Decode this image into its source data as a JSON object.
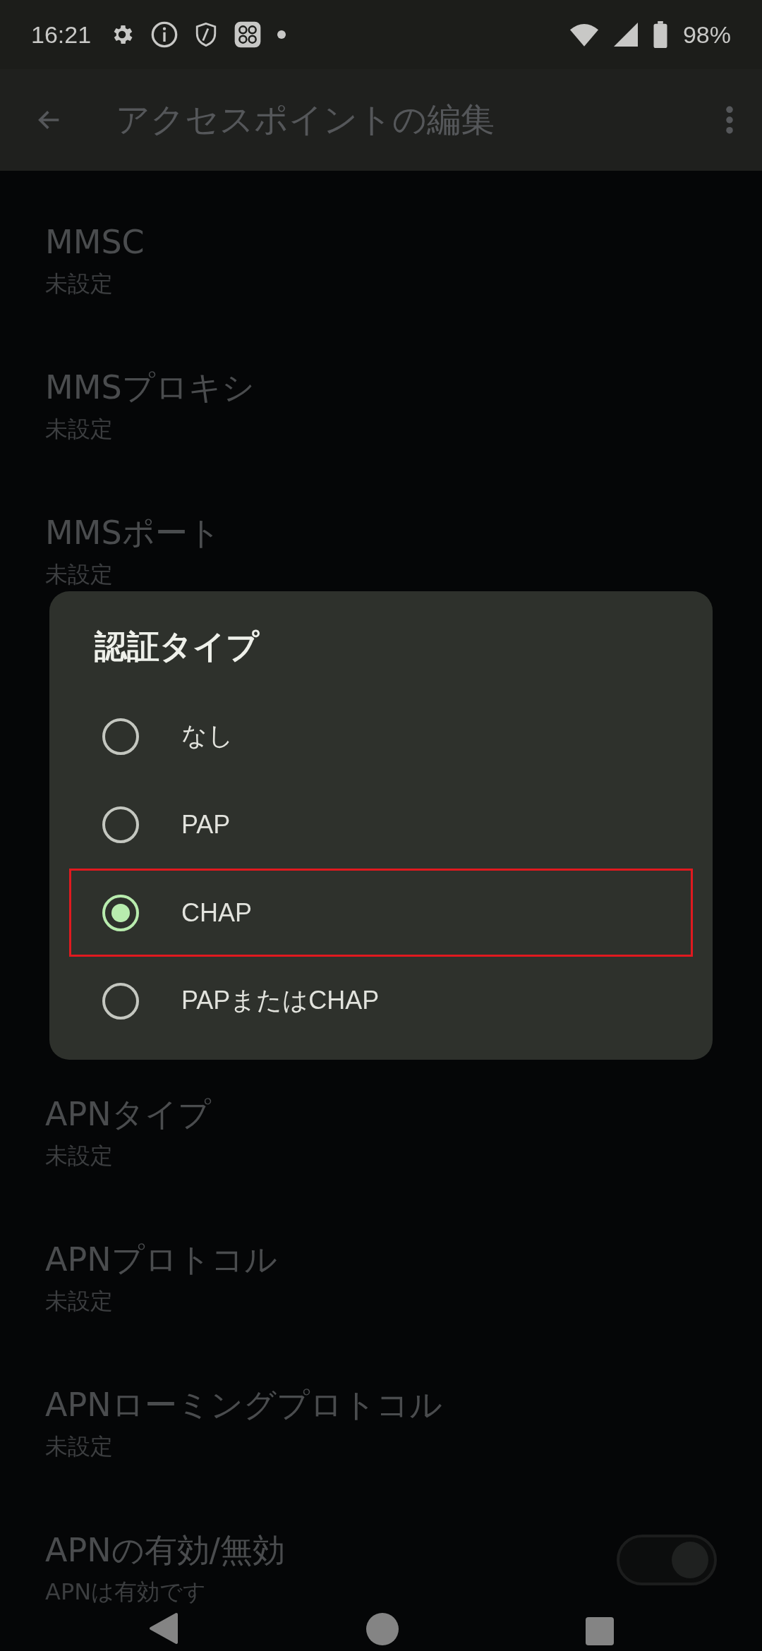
{
  "status_bar": {
    "time": "16:21",
    "battery": "98%"
  },
  "toolbar": {
    "title": "アクセスポイントの編集"
  },
  "settings_top": [
    {
      "title": "MMSC",
      "summary": "未設定"
    },
    {
      "title": "MMSプロキシ",
      "summary": "未設定"
    },
    {
      "title": "MMSポート",
      "summary": "未設定"
    }
  ],
  "settings_bottom": [
    {
      "title": "APNタイプ",
      "summary": "未設定"
    },
    {
      "title": "APNプロトコル",
      "summary": "未設定"
    },
    {
      "title": "APNローミングプロトコル",
      "summary": "未設定"
    },
    {
      "title": "APNの有効/無効",
      "summary": "APNは有効です",
      "kind": "switch",
      "on": true
    }
  ],
  "dialog": {
    "title": "認証タイプ",
    "options": [
      {
        "label": "なし",
        "selected": false,
        "highlighted": false
      },
      {
        "label": "PAP",
        "selected": false,
        "highlighted": false
      },
      {
        "label": "CHAP",
        "selected": true,
        "highlighted": true
      },
      {
        "label": "PAPまたはCHAP",
        "selected": false,
        "highlighted": false
      }
    ]
  }
}
